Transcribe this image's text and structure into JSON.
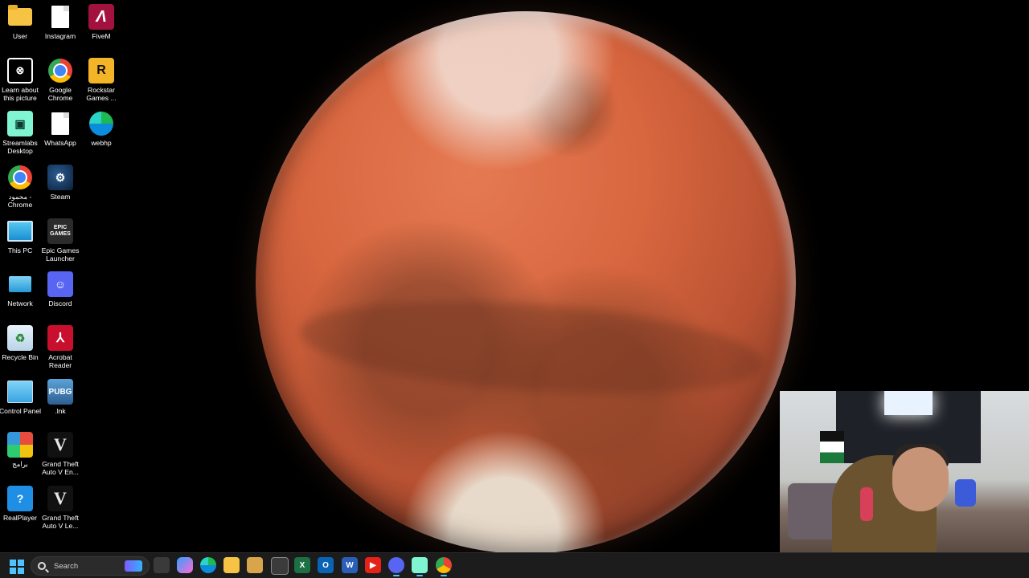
{
  "desktop_icons": {
    "user": "User",
    "instagram": "Instagram",
    "fivem": "FiveM",
    "learn": "Learn about this picture",
    "google_chrome": "Google Chrome",
    "rockstar": "Rockstar Games ...",
    "streamlabs": "Streamlabs Desktop",
    "whatsapp": "WhatsApp",
    "webhp": "webhp",
    "mahmoud_chrome": "محمود - Chrome",
    "steam": "Steam",
    "this_pc": "This PC",
    "epic": "Epic Games Launcher",
    "network": "Network",
    "discord": "Discord",
    "recycle_bin": "Recycle Bin",
    "acrobat": "Acrobat Reader",
    "control_panel": "Control Panel",
    "lnk": ".lnk",
    "baramej": "برامج",
    "gta_en": "Grand Theft Auto V En...",
    "realplayer": "RealPlayer",
    "gta_le": "Grand Theft Auto V Le..."
  },
  "icon_glyphs": {
    "fivem": "Λ",
    "rockstar": "R",
    "streamlabs": "▣",
    "learn": "⊗",
    "steam": "⚙",
    "epic": "EPIC GAMES",
    "discord": "☺",
    "bin": "♻",
    "acrobat": "⅄",
    "gta": "V",
    "real": "?",
    "pubg": "PUBG"
  },
  "taskbar": {
    "search_placeholder": "Search",
    "apps": [
      "task-view",
      "copilot",
      "edge",
      "file-explorer",
      "notepad",
      "store",
      "excel",
      "outlook",
      "word",
      "youtube",
      "discord",
      "streamlabs",
      "chrome"
    ]
  },
  "colors": {
    "taskbar_bg": "#1c1c1c",
    "accent": "#4cc2ff",
    "wallpaper_bg": "#000000"
  }
}
